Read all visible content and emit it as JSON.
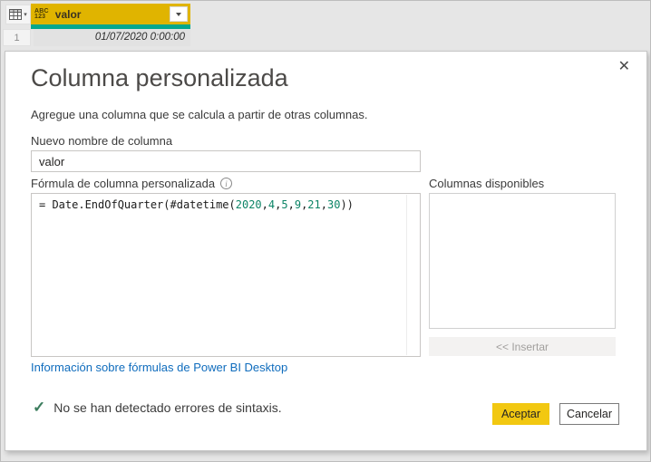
{
  "table": {
    "header": {
      "type_icon_top": "ABC",
      "type_icon_bottom": "123",
      "name": "valor"
    },
    "rows": [
      {
        "num": "1",
        "value": "01/07/2020 0:00:00"
      }
    ]
  },
  "dialog": {
    "title": "Columna personalizada",
    "subtitle": "Agregue una columna que se calcula a partir de otras columnas.",
    "new_column_name": {
      "label": "Nuevo nombre de columna",
      "value": "valor"
    },
    "formula": {
      "label": "Fórmula de columna personalizada",
      "full_text": "= Date.EndOfQuarter(#datetime(2020,4,5,9,21,30))",
      "tokens": [
        {
          "text": "= Date.EndOfQuarter(#datetime(",
          "type": "plain"
        },
        {
          "text": "2020",
          "type": "number"
        },
        {
          "text": ",",
          "type": "plain"
        },
        {
          "text": "4",
          "type": "number"
        },
        {
          "text": ",",
          "type": "plain"
        },
        {
          "text": "5",
          "type": "number"
        },
        {
          "text": ",",
          "type": "plain"
        },
        {
          "text": "9",
          "type": "number"
        },
        {
          "text": ",",
          "type": "plain"
        },
        {
          "text": "21",
          "type": "number"
        },
        {
          "text": ",",
          "type": "plain"
        },
        {
          "text": "30",
          "type": "number"
        },
        {
          "text": "))",
          "type": "plain"
        }
      ]
    },
    "available_columns": {
      "label": "Columnas disponibles",
      "items": []
    },
    "insert_button_label": "<< Insertar",
    "help_link": "Información sobre fórmulas de Power BI Desktop",
    "status": {
      "message": "No se han detectado errores de sintaxis."
    },
    "buttons": {
      "ok": "Aceptar",
      "cancel": "Cancelar"
    }
  },
  "icons": {
    "close": "✕",
    "check": "✓",
    "caret": "▾",
    "info": "i"
  },
  "colors": {
    "header_gold": "#e0b400",
    "accent_gold": "#f2c811",
    "quality_bar_teal": "#04a78e",
    "link_blue": "#0f6cbd",
    "number_token_teal": "#0c8466",
    "status_check_green": "#3c7d5e",
    "dialog_background": "#ffffff",
    "page_background": "#e6e6e6"
  }
}
